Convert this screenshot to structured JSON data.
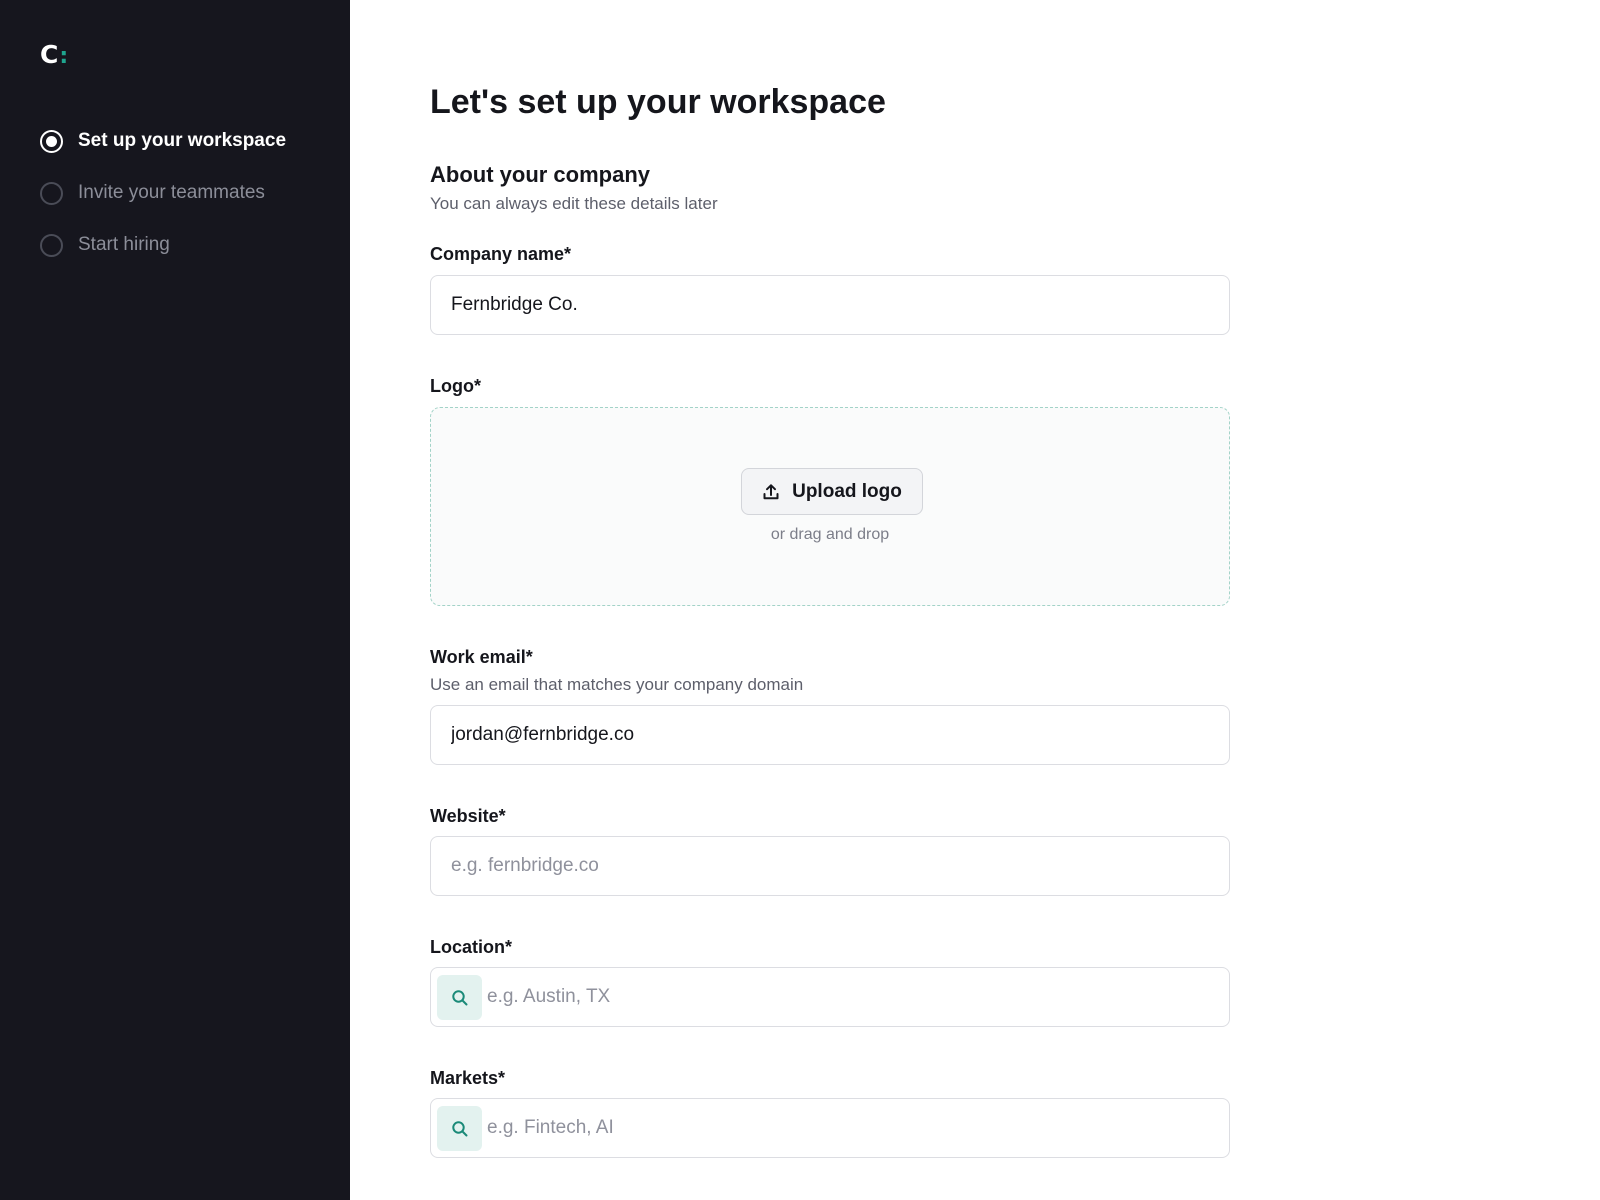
{
  "app": {
    "logo_letter": "C",
    "logo_colon": ":"
  },
  "sidebar": {
    "steps": [
      {
        "label": "Set up your workspace",
        "active": true
      },
      {
        "label": "Invite your teammates",
        "active": false
      },
      {
        "label": "Start hiring",
        "active": false
      }
    ]
  },
  "page": {
    "title": "Let's set up your workspace",
    "section_title": "About your company",
    "section_subtitle": "You can always edit these details later"
  },
  "form": {
    "company_name": {
      "label": "Company name*",
      "value": "Fernbridge Co."
    },
    "logo": {
      "label": "Logo*",
      "upload_label": "Upload logo",
      "drag_text": "or drag and drop"
    },
    "work_email": {
      "label": "Work email*",
      "help": "Use an email that matches your company domain",
      "value": "jordan@fernbridge.co"
    },
    "website": {
      "label": "Website*",
      "placeholder": "e.g. fernbridge.co"
    },
    "location": {
      "label": "Location*",
      "placeholder": "e.g. Austin, TX"
    },
    "markets": {
      "label": "Markets*",
      "placeholder": "e.g. Fintech, AI"
    }
  },
  "colors": {
    "sidebar_bg": "#16161e",
    "accent": "#1fa58f",
    "accent_soft": "#e3f2ef"
  },
  "icons": {
    "upload": "upload-icon",
    "search": "search-icon"
  }
}
